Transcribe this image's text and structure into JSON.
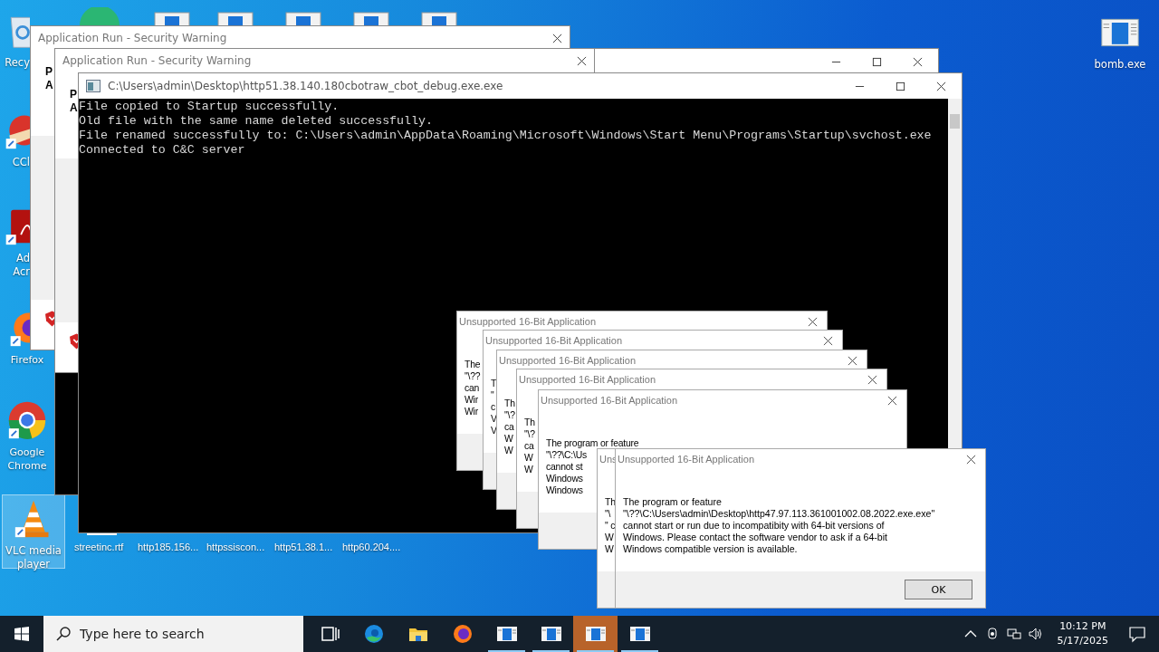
{
  "desktop_icons": [
    {
      "kind": "recycle",
      "lines": [
        "Recy"
      ],
      "selected": false
    },
    {
      "kind": "ccleaner",
      "lines": [
        "CCl"
      ],
      "selected": false
    },
    {
      "kind": "acrobat",
      "lines": [
        "Ad",
        "Acr"
      ],
      "selected": false
    },
    {
      "kind": "firefox",
      "lines": [
        "Firefox"
      ],
      "selected": false
    },
    {
      "kind": "chrome",
      "lines": [
        "Google",
        "Chrome"
      ],
      "selected": false
    },
    {
      "kind": "vlc",
      "lines": [
        "VLC media",
        "player"
      ],
      "selected": true
    }
  ],
  "right_icon": {
    "label": "bomb.exe"
  },
  "desktop_files": [
    "streetinc.rtf",
    "http185.156...",
    "httpssiscon...",
    "http51.38.1...",
    "http60.204...."
  ],
  "security_warnings": [
    {
      "title": "Application Run - Security Warning",
      "lines": [
        "P",
        "A"
      ]
    },
    {
      "title": "Application Run - Security Warning",
      "lines": [
        "P",
        "A"
      ]
    }
  ],
  "console": {
    "title": "C:\\Users\\admin\\Desktop\\http51.38.140.180cbotraw_cbot_debug.exe.exe",
    "lines": [
      "File copied to Startup successfully.",
      "Old file with the same name deleted successfully.",
      "File renamed successfully to: C:\\Users\\admin\\AppData\\Roaming\\Microsoft\\Windows\\Start Menu\\Programs\\Startup\\svchost.exe",
      "Connected to C&C server"
    ]
  },
  "dialogs": [
    {
      "title": "Unsupported 16-Bit Application",
      "lines": [
        "The",
        "\"\\??",
        "can",
        "Wir",
        "Wir"
      ]
    },
    {
      "title": "Unsupported 16-Bit Application",
      "lines": [
        "T",
        "\"",
        "c",
        "V",
        "V"
      ]
    },
    {
      "title": "Unsupported 16-Bit Application",
      "lines": [
        "Th",
        "\"\\?",
        "ca",
        "W",
        "W"
      ]
    },
    {
      "title": "Unsupported 16-Bit Application",
      "lines": [
        "Th",
        "\"\\?",
        "ca",
        "W",
        "W"
      ]
    },
    {
      "title": "Unsupported 16-Bit Application",
      "lines": [
        "The program or feature",
        "\"\\??\\C:\\Us",
        "cannot st",
        "Windows",
        "Windows"
      ]
    },
    {
      "title": "Uns",
      "lines": [
        "Th",
        "\"\\",
        "\" c",
        "W",
        "W"
      ]
    },
    {
      "title": "Unsupported 16-Bit Application",
      "lines": [
        "The program or feature",
        "\"\\??\\C:\\Users\\admin\\Desktop\\http47.97.113.361001002.08.2022.exe.exe\"",
        "cannot start or run due to incompatibity with 64-bit versions of",
        "Windows. Please contact the software vendor to ask if a 64-bit",
        "Windows compatible version is available."
      ],
      "button": "OK"
    }
  ],
  "taskbar": {
    "search_placeholder": "Type here to search",
    "apps": [
      {
        "kind": "taskview",
        "selected": false,
        "running": false
      },
      {
        "kind": "edge",
        "selected": false,
        "running": false
      },
      {
        "kind": "folder",
        "selected": false,
        "running": false
      },
      {
        "kind": "firefox",
        "selected": false,
        "running": false
      },
      {
        "kind": "window",
        "selected": false,
        "running": true
      },
      {
        "kind": "window",
        "selected": false,
        "running": true
      },
      {
        "kind": "window",
        "selected": true,
        "running": true
      },
      {
        "kind": "window",
        "selected": false,
        "running": true
      }
    ],
    "time": "10:12 PM",
    "date": "5/17/2025"
  }
}
